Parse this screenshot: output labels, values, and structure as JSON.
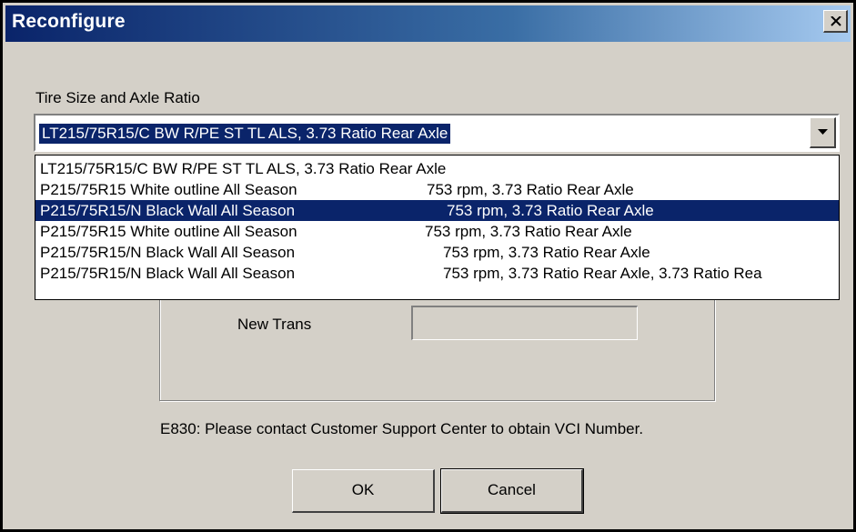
{
  "dialog": {
    "title": "Reconfigure",
    "close_icon": "close-icon"
  },
  "tire": {
    "label": "Tire Size and Axle Ratio",
    "selected_value": "LT215/75R15/C BW R/PE ST TL ALS, 3.73 Ratio Rear Axle",
    "options": [
      {
        "col1": "LT215/75R15/C BW R/PE ST TL ALS, 3.73 Ratio Rear Axle",
        "col2": ""
      },
      {
        "col1": "P215/75R15 White outline All Season",
        "col2": "753 rpm, 3.73 Ratio Rear Axle"
      },
      {
        "col1": "P215/75R15/N Black Wall All Season",
        "col2": "753 rpm, 3.73 Ratio Rear Axle"
      },
      {
        "col1": "P215/75R15 White outline All Season",
        "col2": "753 rpm, 3.73 Ratio Rear Axle"
      },
      {
        "col1": "P215/75R15/N Black Wall All Season",
        "col2": "753 rpm, 3.73 Ratio Rear Axle"
      },
      {
        "col1": "P215/75R15/N Black Wall All Season",
        "col2": "753 rpm, 3.73 Ratio Rear Axle, 3.73 Ratio Rea"
      }
    ],
    "highlighted_index": 2
  },
  "new_trans": {
    "label": "New Trans",
    "value": ""
  },
  "message": "E830: Please contact Customer Support Center to obtain VCI Number.",
  "buttons": {
    "ok": "OK",
    "cancel": "Cancel"
  },
  "colors": {
    "title_bar": "#0a246a",
    "selection": "#0a246a",
    "face": "#d4d0c8"
  }
}
